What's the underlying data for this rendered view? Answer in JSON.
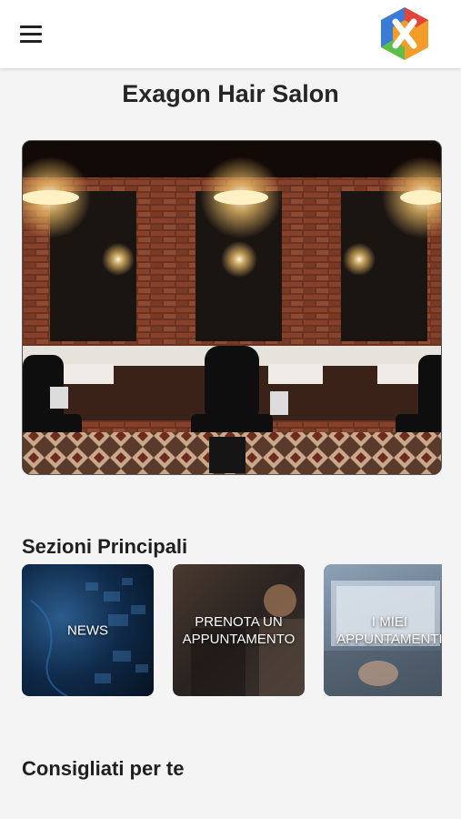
{
  "header": {
    "menu_icon": "hamburger-menu-icon",
    "logo_icon": "exagon-x-logo-icon"
  },
  "page": {
    "title": "Exagon Hair Salon"
  },
  "hero": {
    "image": "barbershop-interior"
  },
  "sections": {
    "main_title": "Sezioni Principali",
    "cards": [
      {
        "label": "NEWS"
      },
      {
        "label": "PRENOTA UN\nAPPUNTAMENTO"
      },
      {
        "label": "I MIEI\nAPPUNTAMENTI"
      }
    ],
    "recommended_title": "Consigliati per te"
  },
  "colors": {
    "background": "#f4f4f5",
    "header": "#ffffff",
    "logo_orange": "#f39c2a",
    "logo_blue": "#3a7bd5",
    "logo_green": "#5bbf4a",
    "logo_red": "#e2463a"
  }
}
